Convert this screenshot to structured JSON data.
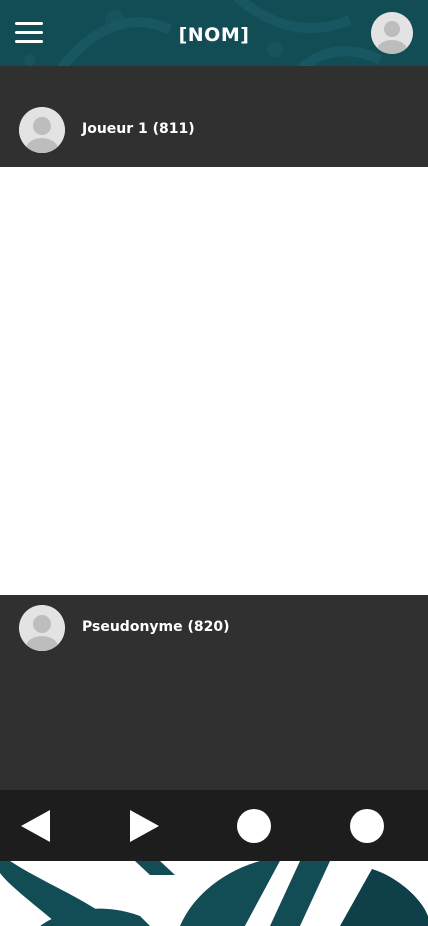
{
  "header": {
    "title": "[NOM]",
    "menu_icon": "hamburger-menu-icon",
    "avatar_icon": "user-avatar-icon",
    "background_color": "#124c55"
  },
  "players": {
    "top": {
      "name": "Joueur 1 (811)",
      "avatar_icon": "user-avatar-icon"
    },
    "bottom": {
      "name": "Pseudonyme (820)",
      "avatar_icon": "user-avatar-icon"
    }
  },
  "controls": {
    "prev_icon": "triangle-left-icon",
    "next_icon": "triangle-right-icon",
    "button3_icon": "circle-icon",
    "button4_icon": "circle-icon"
  },
  "colors": {
    "panel": "#303030",
    "controls": "#1d1d1d",
    "teal": "#124c55",
    "teal_dark": "#0f3f48"
  }
}
